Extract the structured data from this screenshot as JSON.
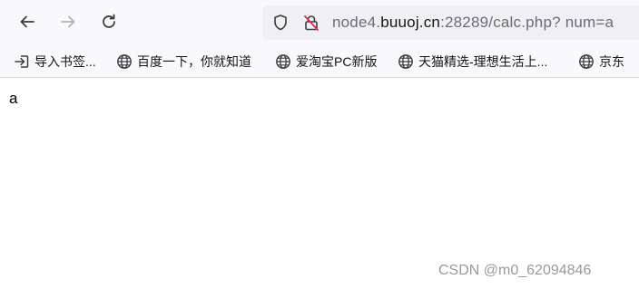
{
  "browser": {
    "url": {
      "prefix": "node4.",
      "host": "buuoj.cn",
      "suffix": ":28289/calc.php? num=a"
    }
  },
  "bookmarks": [
    {
      "label": "导入书签...",
      "icon": "import-icon"
    },
    {
      "label": "百度一下，你就知道",
      "icon": "globe-icon"
    },
    {
      "label": "爱淘宝PC新版",
      "icon": "globe-icon"
    },
    {
      "label": "天猫精选-理想生活上...",
      "icon": "globe-icon"
    },
    {
      "label": "京东",
      "icon": "globe-icon"
    }
  ],
  "page": {
    "body_text": "a"
  },
  "watermark": "CSDN @m0_62094846"
}
